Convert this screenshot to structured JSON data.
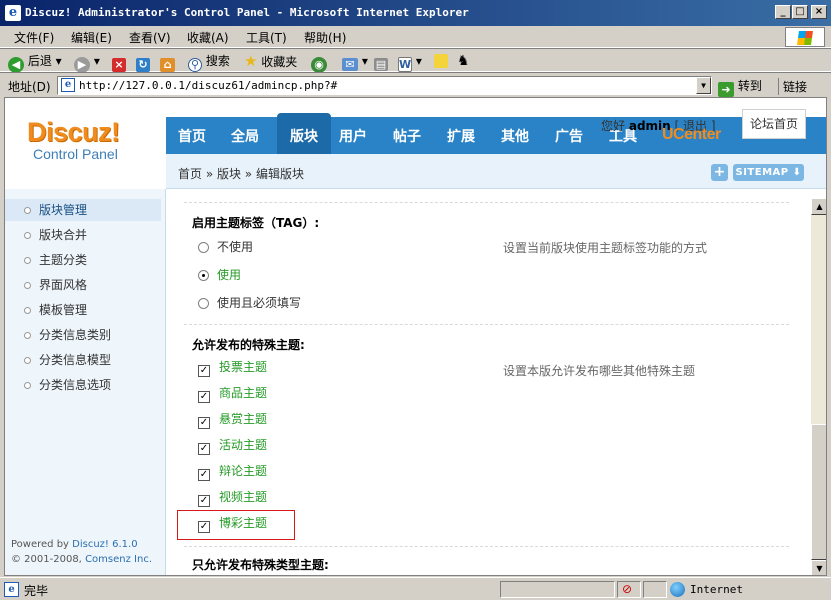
{
  "window": {
    "title": "Discuz! Administrator's Control Panel - Microsoft Internet Explorer",
    "buttons": {
      "minimize": "_",
      "maximize": "□",
      "close": "×"
    }
  },
  "menubar": [
    "文件(F)",
    "编辑(E)",
    "查看(V)",
    "收藏(A)",
    "工具(T)",
    "帮助(H)"
  ],
  "toolbar": {
    "back": "后退",
    "search": "搜索",
    "favorites": "收藏夹"
  },
  "address": {
    "label": "地址(D)",
    "url": "http://127.0.0.1/discuz61/admincp.php?#",
    "go": "转到",
    "links": "链接"
  },
  "header": {
    "brand": "Discuz!",
    "brand_sub": "Control Panel",
    "nav": [
      "首页",
      "全局",
      "版块",
      "用户",
      "帖子",
      "扩展",
      "其他",
      "广告",
      "工具",
      "UCenter"
    ],
    "active_nav": "版块",
    "greeting": "您好",
    "user": "admin",
    "logout": "[ 退出 ]",
    "forum_home": "论坛首页",
    "sitemap": "SITEMAP",
    "plus": "+"
  },
  "breadcrumb": "首页 » 版块 » 编辑版块",
  "sidebar": {
    "items": [
      "版块管理",
      "版块合并",
      "主题分类",
      "界面风格",
      "模板管理",
      "分类信息类别",
      "分类信息模型",
      "分类信息选项"
    ],
    "active": "版块管理",
    "powered_by": "Powered by",
    "product": "Discuz! 6.1.0",
    "copyright": "© 2001-2008,",
    "company": "Comsenz Inc."
  },
  "main": {
    "tag_section": {
      "title": "启用主题标签（TAG）:",
      "options": [
        "不使用",
        "使用",
        "使用且必须填写"
      ],
      "selected_index": 1,
      "hint": "设置当前版块使用主题标签功能的方式"
    },
    "special_section": {
      "title": "允许发布的特殊主题:",
      "items": [
        "投票主题",
        "商品主题",
        "悬赏主题",
        "活动主题",
        "辩论主题",
        "视频主题",
        "博彩主题"
      ],
      "hint": "设置本版允许发布哪些其他特殊主题"
    },
    "only_section": {
      "title": "只允许发布特殊类型主题:"
    }
  },
  "status": {
    "text": "完毕",
    "zone": "Internet"
  },
  "colors": {
    "nav_bg": "#2a83c6",
    "brand_orange": "#f08c1f",
    "option_green": "#249a25",
    "highlight_red": "#d81818"
  }
}
